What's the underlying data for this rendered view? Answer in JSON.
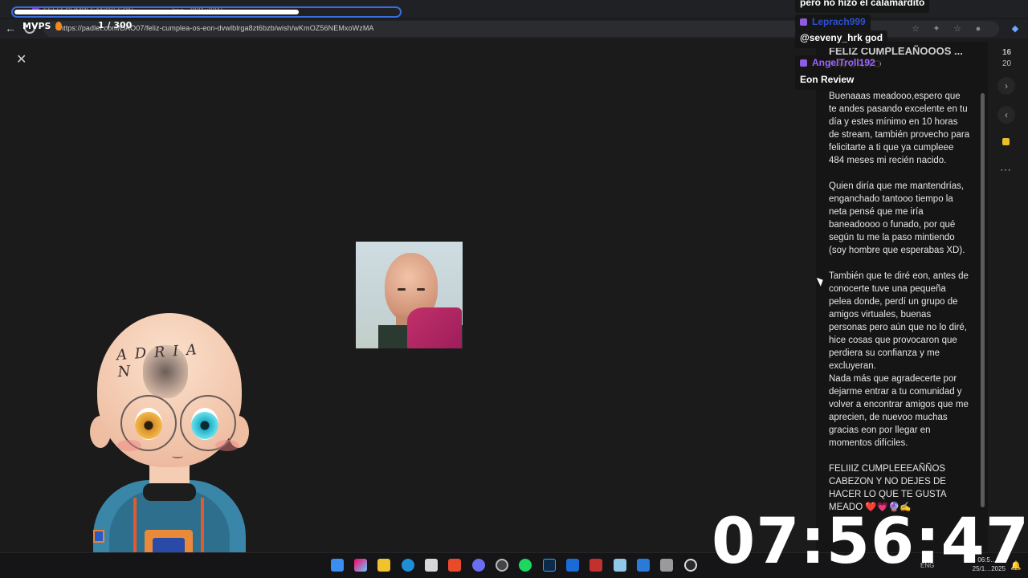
{
  "browser": {
    "tabs": [
      {
        "label": "FELIZ CUMPLEAÑOS EON"
      },
      {
        "label": "Ima...(931×931)"
      }
    ],
    "url": "https://padlet.com/DAO07/feliz-cumplea-os-eon-dvwlblrga8zt6bzb/wish/wKmOZ56NEMxoWzMA"
  },
  "stream_overlay": {
    "brand": "MVPS",
    "goal_counter": "1 / 300",
    "goal_progress": 0.74,
    "clock": "07:56:47"
  },
  "chat": [
    {
      "text": "pero no hizo el calamardito"
    },
    {
      "name": "Leprach999",
      "color": "#2c4fd6"
    },
    {
      "text": "@seveny_hrk god"
    },
    {
      "name": "AngelTroll192",
      "color": "#9b62ff"
    },
    {
      "text": "Eon Review"
    }
  ],
  "post": {
    "close_icon": "close-icon",
    "title": "FELIZ CUMPLEAÑOOOS ... FAVORITO",
    "body": "Buenaaas meadooo,espero que te andes pasando excelente en tu día y estes mínimo en 10 horas de stream, también provecho para felicitarte a ti que ya cumpleee 484 meses mi recién nacido.\n\nQuien diría que me mantendrías, enganchado tantooo tiempo la neta pensé que me iría baneadoooo o funado, por qué según tu me la paso mintiendo (soy hombre que esperabas XD).\n\nTambién que te diré eon, antes de conocerte tuve una pequeña pelea donde, perdí un grupo de amigos virtuales, buenas personas pero aún que no lo diré, hice cosas que provocaron que perdiera su confianza y me excluyeran.\nNada más que agradecerte por dejarme entrar a tu comunidad y volver a encontrar amigos que me aprecien, de nuevoo muchas gracias eon por llegar en momentos difíciles.\n\nFELIIIZ CUMPLEEEAÑÑOS CABEZON Y NO DEJES DE HACER LO QUE TE GUSTA MEADO ❤️💗🔮✍️"
  },
  "rail": {
    "count_top": "16",
    "count_bottom": "20",
    "next_icon": "chevron-right-icon",
    "prev_icon": "chevron-left-icon",
    "note_icon": "note-icon",
    "more_icon": "more-icon"
  },
  "taskbar": {
    "time": "06:5… m.",
    "date": "25/1…2025",
    "lang": "ENG"
  }
}
